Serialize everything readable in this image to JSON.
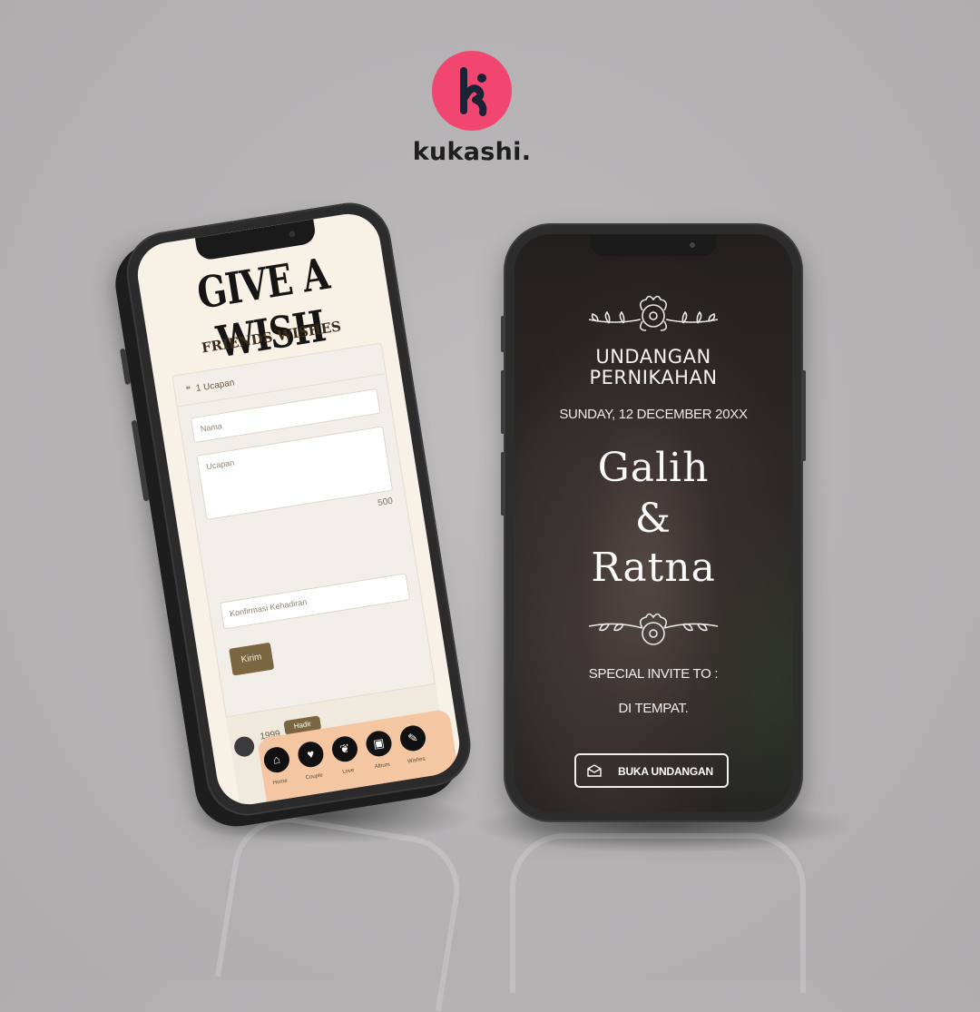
{
  "brand": {
    "logo_letter": "k",
    "name": "kukashi.",
    "color": "#f04670"
  },
  "left_screen": {
    "title": "GIVE A WISH",
    "subtitle": "FRIENDS WISHES",
    "card": {
      "count_label": "1 Ucapan",
      "name_placeholder": "Nama",
      "message_placeholder": "Ucapan",
      "char_count": "500",
      "attendance_placeholder": "Konfirmasi Kehadiran",
      "submit_label": "Kirim"
    },
    "bottom": {
      "count": "1999",
      "pill_label": "Hadir"
    },
    "nav": [
      {
        "icon": "home-icon",
        "glyph": "⌂",
        "label": "Home"
      },
      {
        "icon": "couple-icon",
        "glyph": "♥",
        "label": "Couple"
      },
      {
        "icon": "love-icon",
        "glyph": "❦",
        "label": "Love"
      },
      {
        "icon": "album-icon",
        "glyph": "▣",
        "label": "Album"
      },
      {
        "icon": "wishes-icon",
        "glyph": "✎",
        "label": "Wishes"
      }
    ],
    "accent": "#7c6641",
    "nav_color": "#f4c7a2"
  },
  "right_screen": {
    "title_line1": "UNDANGAN",
    "title_line2": "PERNIKAHAN",
    "date": "SUNDAY, 12 DECEMBER 20XX",
    "groom": "Galih",
    "ampersand": "&",
    "bride": "Ratna",
    "invite_label": "SPECIAL INVITE TO :",
    "place": "DI TEMPAT.",
    "open_button": "BUKA UNDANGAN",
    "button_icon": "envelope-icon"
  }
}
